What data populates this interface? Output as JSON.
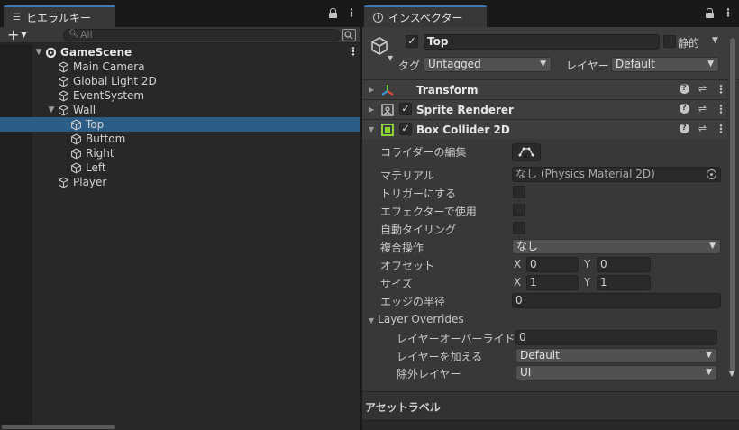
{
  "hierarchy": {
    "tab_label": "ヒエラルキー",
    "add_label": "+",
    "search_placeholder": "All",
    "tree": [
      {
        "label": "GameScene",
        "kind": "scene",
        "depth": 0,
        "expanded": true,
        "selected": false
      },
      {
        "label": "Main Camera",
        "kind": "object",
        "depth": 1,
        "selected": false
      },
      {
        "label": "Global Light 2D",
        "kind": "object",
        "depth": 1,
        "selected": false
      },
      {
        "label": "EventSystem",
        "kind": "object",
        "depth": 1,
        "selected": false
      },
      {
        "label": "Wall",
        "kind": "object",
        "depth": 1,
        "expanded": true,
        "selected": false
      },
      {
        "label": "Top",
        "kind": "object",
        "depth": 2,
        "selected": true
      },
      {
        "label": "Buttom",
        "kind": "object",
        "depth": 2,
        "selected": false
      },
      {
        "label": "Right",
        "kind": "object",
        "depth": 2,
        "selected": false
      },
      {
        "label": "Left",
        "kind": "object",
        "depth": 2,
        "selected": false
      },
      {
        "label": "Player",
        "kind": "object",
        "depth": 1,
        "selected": false
      }
    ]
  },
  "inspector": {
    "tab_label": "インスペクター",
    "object": {
      "active": true,
      "name": "Top",
      "static_label": "静的",
      "static_checked": false,
      "tag_label": "タグ",
      "tag_value": "Untagged",
      "layer_label": "レイヤー",
      "layer_value": "Default"
    },
    "components": {
      "transform": {
        "name": "Transform"
      },
      "sprite_renderer": {
        "name": "Sprite Renderer",
        "enabled": true
      },
      "box_collider": {
        "name": "Box Collider 2D",
        "enabled": true
      }
    },
    "box_collider_props": {
      "edit_collider_label": "コライダーの編集",
      "material_label": "マテリアル",
      "material_value": "なし (Physics Material 2D)",
      "trigger_label": "トリガーにする",
      "trigger_checked": false,
      "effector_label": "エフェクターで使用",
      "effector_checked": false,
      "autotiling_label": "自動タイリング",
      "autotiling_checked": false,
      "composite_label": "複合操作",
      "composite_value": "なし",
      "offset_label": "オフセット",
      "offset_x": "0",
      "offset_y": "0",
      "size_label": "サイズ",
      "size_x": "1",
      "size_y": "1",
      "edge_radius_label": "エッジの半径",
      "edge_radius_value": "0",
      "x_label": "X",
      "y_label": "Y",
      "layer_overrides_label": "Layer Overrides",
      "layer_override_priority_label": "レイヤーオーバーライド",
      "layer_override_priority_value": "0",
      "include_layers_label": "レイヤーを加える",
      "include_layers_value": "Default",
      "exclude_layers_label": "除外レイヤー",
      "exclude_layers_value": "UI"
    },
    "asset_labels_label": "アセットラベル"
  },
  "colors": {
    "selection": "#2c5d87",
    "tab_accent": "#3a79bb",
    "panel_bg": "#383838",
    "collider_green": "#8ed23a"
  }
}
